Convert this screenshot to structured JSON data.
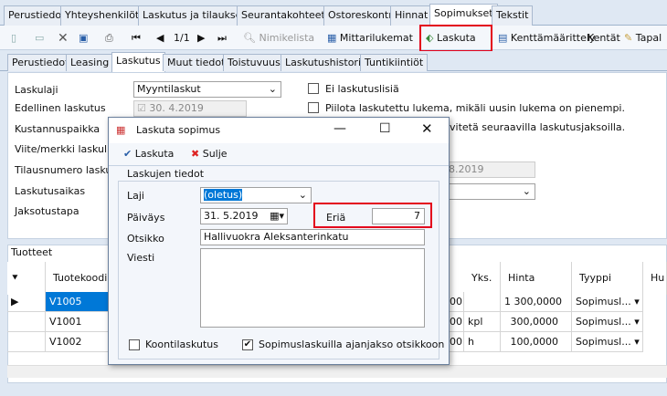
{
  "top_tabs": [
    "Perustiedot",
    "Yhteyshenkilöt",
    "Laskutus ja tilaukset",
    "Seurantakohteet",
    "Ostoreskontra",
    "Hinnat",
    "Sopimukset",
    "Tekstit"
  ],
  "toolbar": {
    "page": "1/1",
    "nimikelista": "Nimikelista",
    "mittarilukemat": "Mittarilukemat",
    "laskuta": "Laskuta",
    "kenttamaarittely": "Kenttämäärittely",
    "kentat": "Kentät",
    "tapal": "Tapal"
  },
  "sub_tabs": [
    "Perustiedot",
    "Leasing",
    "Laskutus",
    "Muut tiedot",
    "Toistuvuus",
    "Laskutushistoria",
    "Tuntikiintiöt"
  ],
  "form": {
    "laskulaji_label": "Laskulaji",
    "laskulaji_value": "Myyntilaskut",
    "edellinen_label": "Edellinen laskutus",
    "edellinen_value": "30. 4.2019",
    "kustannus_label": "Kustannuspaikka",
    "viite_label": "Viite/merkki laskulle",
    "tilaus_label": "Tilausnumero laskulle",
    "tilaus_date": ". 8.2019",
    "laskutusaikas_label": "Laskutusaikas",
    "jaksotus_label": "Jaksotustapa",
    "ei_lisaa": "Ei laskutuslisiä",
    "piilota": "Piilota laskutettu lukema, mikäli uusin lukema on pienempi.",
    "vitetaan": "vitetä seuraavilla laskutusjaksoilla."
  },
  "grid": {
    "title": "Tuotteet",
    "headers": [
      "Tuotekoodi",
      "Yks.",
      "Hinta",
      "Tyyppi",
      "Hu"
    ],
    "rows": [
      {
        "code": "V1005",
        "qty": "00",
        "unit": "",
        "price": "1 300,0000",
        "type": "Sopimusl..."
      },
      {
        "code": "V1001",
        "qty": "00",
        "unit": "kpl",
        "price": "300,0000",
        "type": "Sopimusl..."
      },
      {
        "code": "V1002",
        "qty": "00",
        "unit": "h",
        "price": "100,0000",
        "type": "Sopimusl..."
      }
    ]
  },
  "dialog": {
    "title": "Laskuta sopimus",
    "laskuta": "Laskuta",
    "sulje": "Sulje",
    "group": "Laskujen tiedot",
    "laji_label": "Laji",
    "laji_value": "(oletus)",
    "paivays_label": "Päiväys",
    "paivays_value": "31. 5.2019",
    "eria_label": "Eriä",
    "eria_value": "7",
    "otsikko_label": "Otsikko",
    "otsikko_value": "Hallivuokra Aleksanterinkatu",
    "viesti_label": "Viesti",
    "koonti": "Koontilaskutus",
    "sopimus_otsikko": "Sopimuslaskuilla ajanjakso otsikkoon"
  }
}
